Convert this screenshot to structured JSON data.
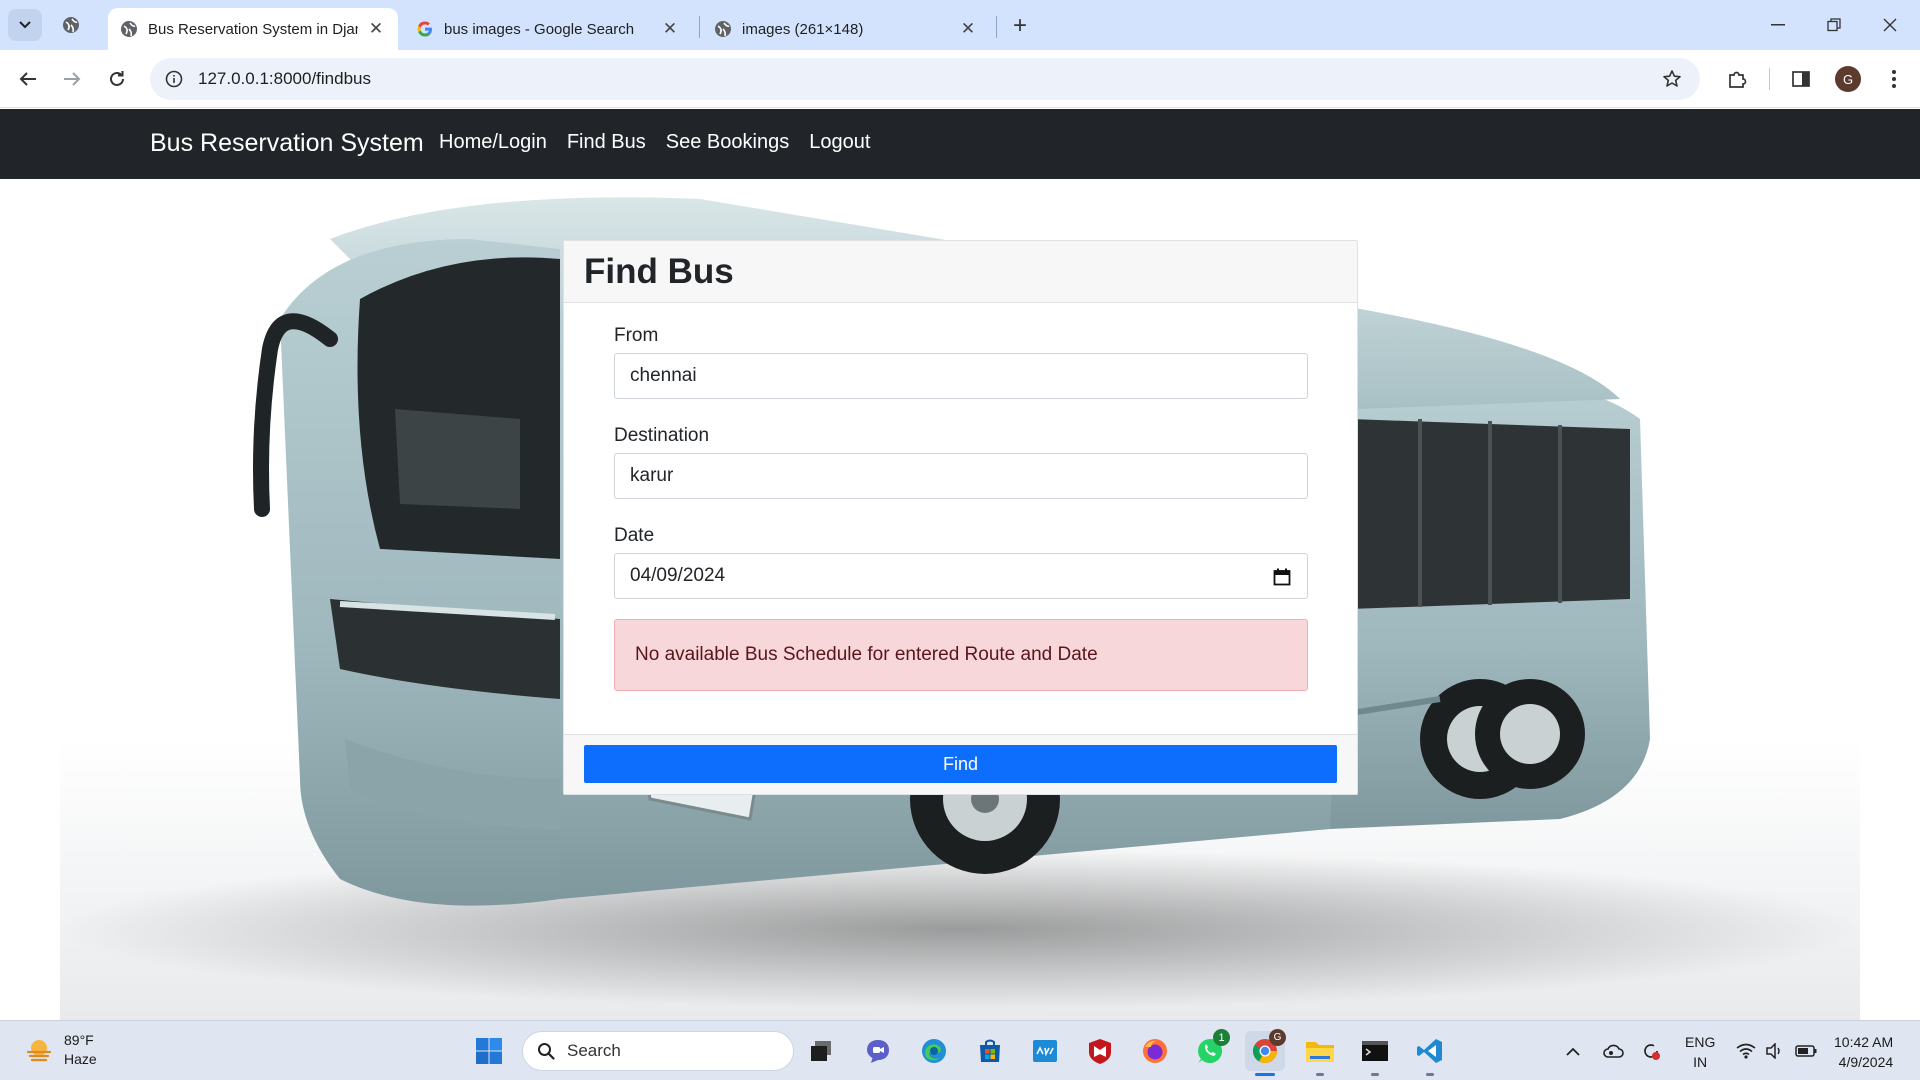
{
  "browser": {
    "tabs": [
      {
        "title": "Bus Reservation System in Djan",
        "active": true
      },
      {
        "title": "bus images - Google Search",
        "active": false
      },
      {
        "title": "images (261×148)",
        "active": false
      }
    ],
    "url": "127.0.0.1:8000/findbus",
    "profile_initial": "G"
  },
  "navbar": {
    "brand": "Bus Reservation System",
    "links": [
      "Home/Login",
      "Find Bus",
      "See Bookings",
      "Logout"
    ]
  },
  "form": {
    "title": "Find Bus",
    "from_label": "From",
    "from_value": "chennai",
    "destination_label": "Destination",
    "destination_value": "karur",
    "date_label": "Date",
    "date_value": "04/09/2024",
    "alert": "No available Bus Schedule for entered Route and Date",
    "submit_label": "Find"
  },
  "taskbar": {
    "weather_temp": "89°F",
    "weather_desc": "Haze",
    "search_label": "Search",
    "whatsapp_badge": "1",
    "chrome_badge": "G",
    "lang_top": "ENG",
    "lang_bottom": "IN",
    "time": "10:42 AM",
    "date": "4/9/2024"
  },
  "colors": {
    "navbar_bg": "#212529",
    "primary": "#0d6efd",
    "alert_bg": "#f8d7da",
    "alert_text": "#58151c",
    "tabbar_bg": "#d3e3fd"
  }
}
